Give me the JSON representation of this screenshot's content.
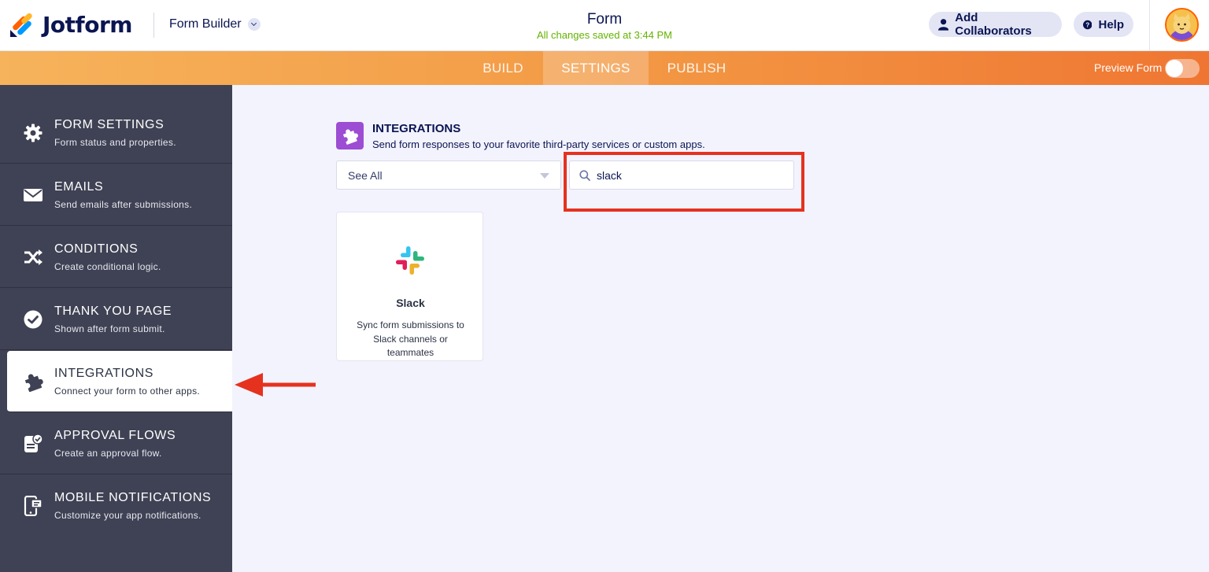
{
  "header": {
    "brand": "Jotform",
    "builder_label": "Form Builder",
    "form_title": "Form",
    "save_status": "All changes saved at 3:44 PM",
    "collaborators_label": "Add Collaborators",
    "help_label": "Help"
  },
  "nav": {
    "tabs": [
      {
        "label": "BUILD"
      },
      {
        "label": "SETTINGS",
        "active": true
      },
      {
        "label": "PUBLISH"
      }
    ],
    "preview_label": "Preview Form",
    "preview_enabled": false
  },
  "sidebar": {
    "items": [
      {
        "title": "FORM SETTINGS",
        "subtitle": "Form status and properties.",
        "icon": "gear-icon"
      },
      {
        "title": "EMAILS",
        "subtitle": "Send emails after submissions.",
        "icon": "envelope-icon"
      },
      {
        "title": "CONDITIONS",
        "subtitle": "Create conditional logic.",
        "icon": "shuffle-icon"
      },
      {
        "title": "THANK YOU PAGE",
        "subtitle": "Shown after form submit.",
        "icon": "check-circle-icon"
      },
      {
        "title": "INTEGRATIONS",
        "subtitle": "Connect your form to other apps.",
        "icon": "puzzle-icon",
        "active": true
      },
      {
        "title": "APPROVAL FLOWS",
        "subtitle": "Create an approval flow.",
        "icon": "approval-icon"
      },
      {
        "title": "MOBILE NOTIFICATIONS",
        "subtitle": "Customize your app notifications.",
        "icon": "mobile-icon"
      }
    ]
  },
  "integrations": {
    "title": "INTEGRATIONS",
    "subtitle": "Send form responses to your favorite third-party services or custom apps.",
    "filter_value": "See All",
    "search_value": "slack",
    "results": [
      {
        "name": "Slack",
        "description": "Sync form submissions to Slack channels or teammates",
        "icon": "slack-icon"
      }
    ]
  },
  "annotations": {
    "highlight_color": "#e5321f",
    "arrow_color": "#e5321f"
  },
  "colors": {
    "accent": "#ff6100",
    "navy": "#0a1551",
    "sidebar_bg": "#3f4254",
    "saved_green": "#64b200"
  }
}
